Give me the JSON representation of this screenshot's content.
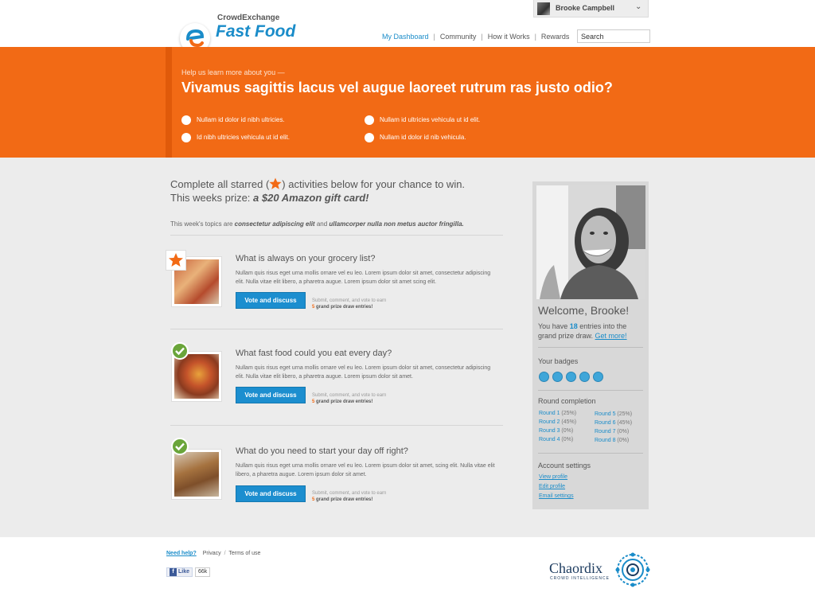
{
  "header": {
    "brand_top": "CrowdExchange",
    "brand_main": "Fast Food",
    "user_name": "Brooke Campbell",
    "nav": [
      {
        "label": "My Dashboard"
      },
      {
        "label": "Community"
      },
      {
        "label": "How it Works"
      },
      {
        "label": "Rewards"
      }
    ],
    "search_placeholder": "Search"
  },
  "banner": {
    "kicker": "Help us learn more about you —",
    "question": "Vivamus sagittis lacus vel augue laoreet rutrum ras justo odio?",
    "options": [
      "Nullam id dolor id nibh ultricies.",
      "Id nibh ultricies vehicula ut id elit.",
      "Nullam id ultricies vehicula ut id elit.",
      "Nullam id dolor id nib vehicula."
    ]
  },
  "intro": {
    "line1_pre": "Complete all starred (",
    "line1_post": ") activities below for your chance to win.",
    "line2_pre": "This weeks prize: ",
    "line2_prize": "a $20 Amazon gift card!",
    "topics_pre": "This week's topics are ",
    "topics_a": "consectetur adipiscing elit",
    "topics_mid": " and ",
    "topics_b": "ullamcorper nulla non metus auctor fringilla."
  },
  "activities": [
    {
      "title": "What is always on your grocery list?",
      "desc": "Nullam quis risus eget urna mollis ornare vel eu leo. Lorem ipsum dolor sit amet, consectetur adipiscing elit. Nulla vitae elit libero, a pharetra augue. Lorem ipsum dolor sit amet scing elit.",
      "button": "Vote and discuss",
      "note": "Submit, comment, and vote to earn",
      "note_num": "5",
      "note_bold": " grand prize draw entries!",
      "status": "starred"
    },
    {
      "title": "What fast food could you eat every day?",
      "desc": "Nullam quis risus eget urna mollis ornare vel eu leo. Lorem ipsum dolor sit amet, consectetur adipiscing elit. Nulla vitae elit libero, a pharetra augue. Lorem ipsum dolor sit amet.",
      "button": "Vote and discuss",
      "note": "Submit, comment, and vote to earn",
      "note_num": "5",
      "note_bold": " grand prize draw entries!",
      "status": "completed"
    },
    {
      "title": "What do you need to start your day off right?",
      "desc": "Nullam quis risus eget urna mollis ornare vel eu leo. Lorem ipsum dolor sit amet, scing elit. Nulla vitae elit libero, a pharetra augue. Lorem ipsum dolor sit amet.",
      "button": "Vote and discuss",
      "note": "Submit, comment, and vote to earn",
      "note_num": "5",
      "note_bold": " grand prize draw entries!",
      "status": "completed"
    }
  ],
  "sidebar": {
    "welcome": "Welcome, Brooke!",
    "entries_pre": "You have ",
    "entries_num": "18",
    "entries_post": " entries into the grand prize draw. ",
    "get_more": "Get more!",
    "badges_title": "Your badges",
    "rounds_title": "Round completion",
    "rounds": [
      {
        "label": "Round 1",
        "pct": "(25%)"
      },
      {
        "label": "Round 2",
        "pct": "(45%)"
      },
      {
        "label": "Round 3",
        "pct": "(0%)"
      },
      {
        "label": "Round 4",
        "pct": "(0%)"
      },
      {
        "label": "Round 5",
        "pct": "(25%)"
      },
      {
        "label": "Round 6",
        "pct": "(45%)"
      },
      {
        "label": "Round 7",
        "pct": "(0%)"
      },
      {
        "label": "Round 8",
        "pct": "(0%)"
      }
    ],
    "account_title": "Account settings",
    "account_links": [
      "View profile",
      "Edit profile",
      "Email settings"
    ]
  },
  "footer": {
    "need_help": "Need help?",
    "privacy": "Privacy",
    "terms": "Terms of use",
    "like": "Like",
    "like_count": "66k",
    "chaordix": "Chaordix",
    "chaordix_sub": "CROWD INTELLIGENCE"
  },
  "colors": {
    "accent_orange": "#f26a15",
    "link_blue": "#1a8cc9",
    "check_green": "#6aa53a"
  }
}
